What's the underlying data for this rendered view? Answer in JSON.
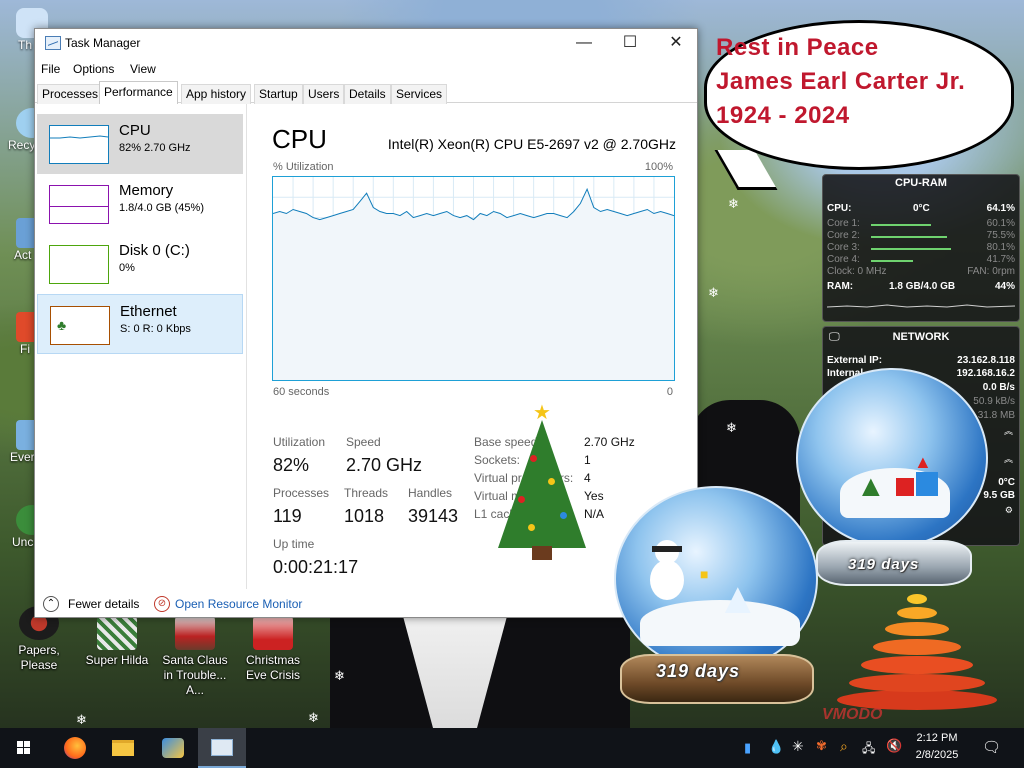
{
  "task_manager": {
    "title": "Task Manager",
    "window_buttons": {
      "minimize": "—",
      "maximize": "☐",
      "close": "✕"
    },
    "menu": [
      "File",
      "Options",
      "View"
    ],
    "tabs": [
      "Processes",
      "Performance",
      "App history",
      "Startup",
      "Users",
      "Details",
      "Services"
    ],
    "active_tab": "Performance",
    "sidebar": [
      {
        "name": "CPU",
        "detail": "82%  2.70 GHz",
        "color": "#117dbb"
      },
      {
        "name": "Memory",
        "detail": "1.8/4.0 GB (45%)",
        "color": "#8b12ae"
      },
      {
        "name": "Disk 0 (C:)",
        "detail": "0%",
        "color": "#4da60c"
      },
      {
        "name": "Ethernet",
        "detail": "S: 0  R: 0 Kbps",
        "color": "#a74f01"
      }
    ],
    "cpu": {
      "heading": "CPU",
      "model": "Intel(R) Xeon(R) CPU E5-2697 v2 @ 2.70GHz",
      "graph_label": "% Utilization",
      "graph_max": "100%",
      "graph_span": "60 seconds",
      "graph_min": "0",
      "utilization_history": [
        82,
        83,
        82,
        84,
        83,
        82,
        80,
        79,
        80,
        81,
        82,
        83,
        84,
        88,
        92,
        85,
        83,
        82,
        82,
        81,
        83,
        80,
        81,
        82,
        81,
        82,
        83,
        81,
        80,
        81,
        79,
        82,
        81,
        83,
        82,
        80,
        81,
        82,
        81,
        80,
        81,
        82,
        82,
        81,
        80,
        83,
        87,
        94,
        85,
        83,
        84,
        83,
        82,
        81,
        82,
        83,
        84,
        82,
        83,
        82,
        81
      ],
      "stats": {
        "utilization_label": "Utilization",
        "utilization": "82%",
        "speed_label": "Speed",
        "speed": "2.70 GHz",
        "processes_label": "Processes",
        "processes": "119",
        "threads_label": "Threads",
        "threads": "1018",
        "handles_label": "Handles",
        "handles": "39143",
        "uptime_label": "Up time",
        "uptime": "0:00:21:17"
      },
      "details": [
        {
          "label": "Base speed:",
          "value": "2.70 GHz"
        },
        {
          "label": "Sockets:",
          "value": "1"
        },
        {
          "label": "Virtual processors:",
          "value": "4"
        },
        {
          "label": "Virtual machine:",
          "value": "Yes"
        },
        {
          "label": "L1 cache:",
          "value": "N/A"
        }
      ]
    },
    "footer": {
      "fewer_details": "Fewer details",
      "resource_monitor": "Open Resource Monitor"
    }
  },
  "bubble": {
    "lines": [
      "Rest in Peace",
      "James Earl Carter Jr.",
      "1924 - 2024"
    ]
  },
  "cpu_ram_gadget": {
    "title": "CPU-RAM",
    "cpu_label": "CPU:",
    "cpu_temp": "0°C",
    "cpu_value": "64.1%",
    "cores": [
      {
        "label": "Core 1:",
        "value": "60.1%",
        "level": 0.6
      },
      {
        "label": "Core 2:",
        "value": "75.5%",
        "level": 0.755
      },
      {
        "label": "Core 3:",
        "value": "80.1%",
        "level": 0.8
      },
      {
        "label": "Core 4:",
        "value": "41.7%",
        "level": 0.417
      }
    ],
    "clock": "Clock: 0 MHz",
    "fan": "FAN: 0rpm",
    "ram_label": "RAM:",
    "ram_value": "1.8 GB/4.0 GB",
    "ram_pct": "44%"
  },
  "network_gadget": {
    "title": "NETWORK",
    "external_ip_label": "External IP:",
    "external_ip": "23.162.8.118",
    "internal_label": "Internal",
    "internal_ip": "192.168.16.2",
    "row3": "0.0 B/s",
    "row4": "50.9 kB/s",
    "row5": "31.8 MB",
    "temp": "0°C",
    "size": "9.5 GB"
  },
  "globes": {
    "left_days": "319 days",
    "right_days": "319 days"
  },
  "watermark": "VMODO",
  "desktop_icons": [
    {
      "label": "Papers, Please"
    },
    {
      "label": "Super Hilda"
    },
    {
      "label": "Santa Claus in Trouble... A..."
    },
    {
      "label": "Christmas Eve Crisis"
    }
  ],
  "desktop_left_labels": [
    "Th",
    "Recy",
    "Act",
    "Fi",
    "Ever",
    "Unc"
  ],
  "clock": {
    "time": "2:12 PM",
    "date": "2/8/2025"
  }
}
